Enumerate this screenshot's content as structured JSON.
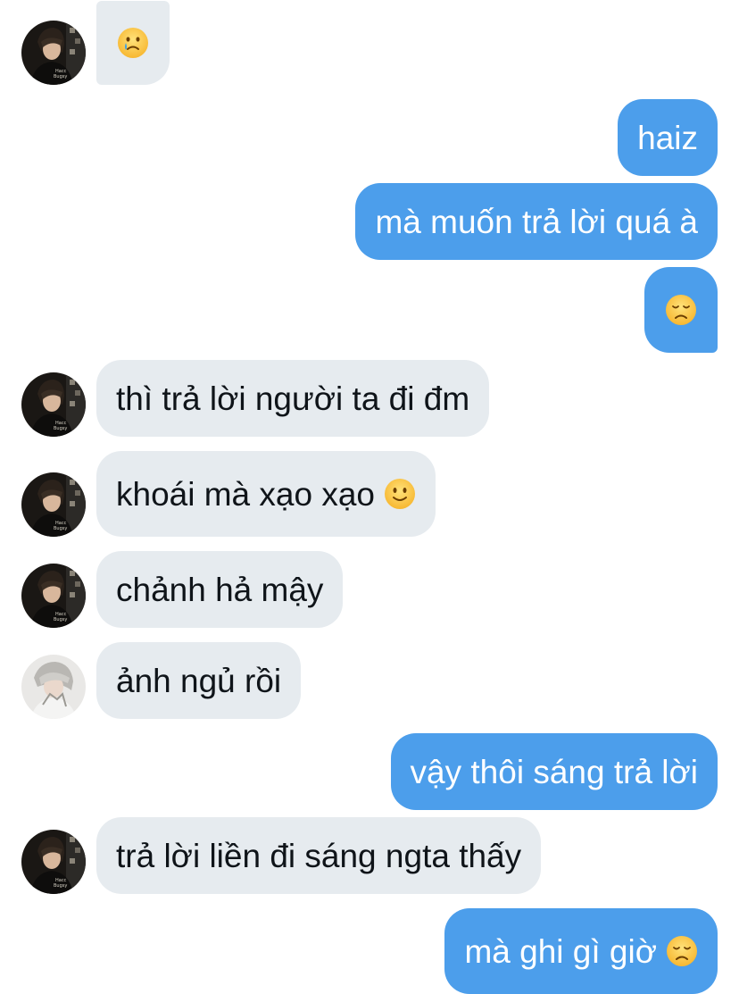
{
  "conversation": {
    "messages": [
      {
        "id": "m1",
        "side": "incoming",
        "text": "",
        "emoji": "crying-face-icon",
        "emoji_char": "🥲",
        "avatar": "user-a"
      },
      {
        "id": "m2",
        "side": "outgoing",
        "text": "haiz"
      },
      {
        "id": "m3",
        "side": "outgoing",
        "text": "mà muốn trả lời quá à"
      },
      {
        "id": "m4",
        "side": "outgoing",
        "text": "",
        "emoji": "disappointed-face-icon",
        "emoji_char": "😞"
      },
      {
        "id": "m5",
        "side": "incoming",
        "text": "thì trả lời người ta đi đm",
        "avatar": "user-a"
      },
      {
        "id": "m6",
        "side": "incoming",
        "text": "khoái mà xạo xạo",
        "emoji": "slightly-smiling-face-icon",
        "emoji_char": "🙂",
        "avatar": "user-a"
      },
      {
        "id": "m7",
        "side": "incoming",
        "text": "chảnh hả mậy",
        "avatar": "user-a"
      },
      {
        "id": "m8",
        "side": "incoming",
        "text": "ảnh ngủ rồi",
        "avatar": "user-b"
      },
      {
        "id": "m9",
        "side": "outgoing",
        "text": "vậy thôi sáng trả lời"
      },
      {
        "id": "m10",
        "side": "incoming",
        "text": "trả lời liền đi sáng ngta thấy",
        "avatar": "user-a"
      },
      {
        "id": "m11",
        "side": "outgoing",
        "text": "mà ghi gì giờ",
        "emoji": "disappointed-face-icon",
        "emoji_char": "😞"
      }
    ]
  },
  "colors": {
    "incoming_bubble": "#e6ebef",
    "outgoing_bubble": "#4c9eeb",
    "incoming_text": "#0f1419",
    "outgoing_text": "#ffffff"
  }
}
